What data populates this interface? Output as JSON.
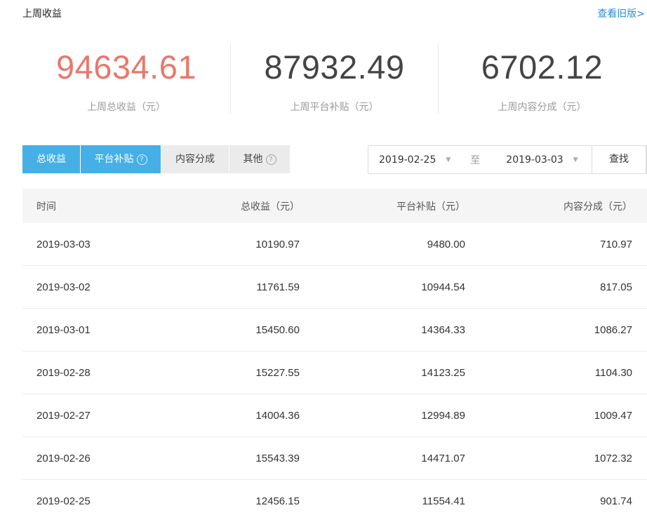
{
  "header": {
    "title": "上周收益",
    "old_version_link": "查看旧版>"
  },
  "stats": [
    {
      "value": "94634.61",
      "label": "上周总收益（元）"
    },
    {
      "value": "87932.49",
      "label": "上周平台补贴（元）"
    },
    {
      "value": "6702.12",
      "label": "上周内容分成（元）"
    }
  ],
  "tabs": [
    {
      "label": "总收益"
    },
    {
      "label": "平台补贴"
    },
    {
      "label": "内容分成"
    },
    {
      "label": "其他"
    }
  ],
  "date_range": {
    "start": "2019-02-25",
    "separator": "至",
    "end": "2019-03-03",
    "search_label": "查找"
  },
  "table": {
    "columns": [
      "时间",
      "总收益（元）",
      "平台补贴（元）",
      "内容分成（元）"
    ],
    "rows": [
      [
        "2019-03-03",
        "10190.97",
        "9480.00",
        "710.97"
      ],
      [
        "2019-03-02",
        "11761.59",
        "10944.54",
        "817.05"
      ],
      [
        "2019-03-01",
        "15450.60",
        "14364.33",
        "1086.27"
      ],
      [
        "2019-02-28",
        "15227.55",
        "14123.25",
        "1104.30"
      ],
      [
        "2019-02-27",
        "14004.36",
        "12994.89",
        "1009.47"
      ],
      [
        "2019-02-26",
        "15543.39",
        "14471.07",
        "1072.32"
      ],
      [
        "2019-02-25",
        "12456.15",
        "11554.41",
        "901.74"
      ]
    ]
  },
  "colors": {
    "accent_red": "#e8786b",
    "tab_active": "#45b0e6",
    "link_blue": "#2a8fd6"
  }
}
